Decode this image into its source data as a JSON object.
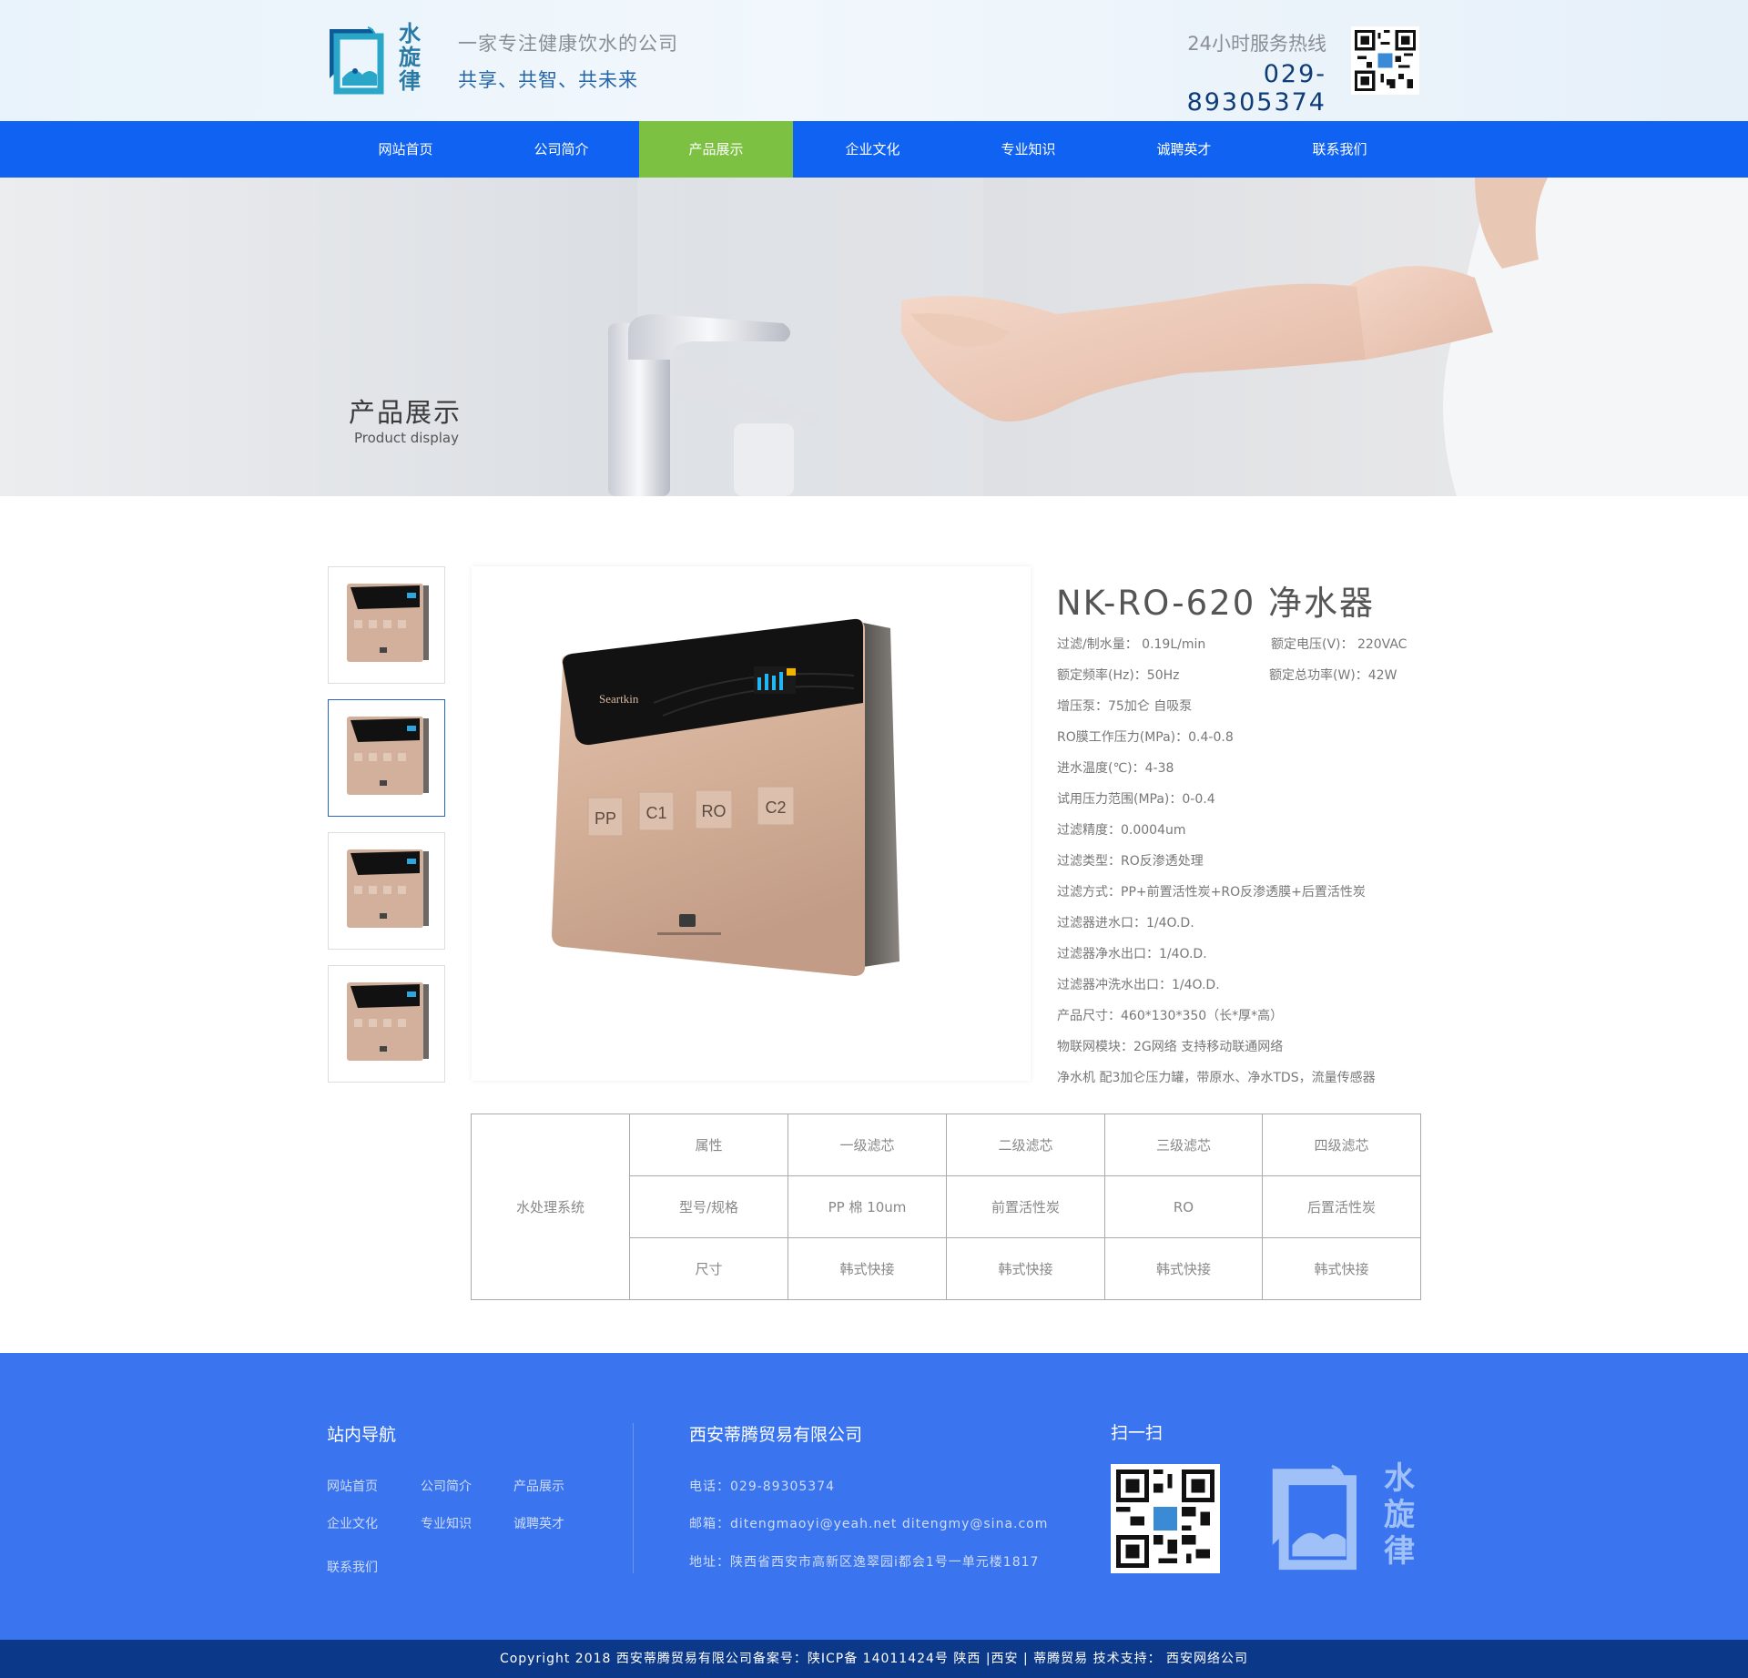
{
  "header": {
    "logo_text": "水旋律",
    "slogan_line1": "一家专注健康饮水的公司",
    "slogan_line2": "共享、共智、共未来",
    "hotline_label": "24小时服务热线",
    "hotline_number": "029-89305374"
  },
  "nav": {
    "items": [
      {
        "label": "网站首页"
      },
      {
        "label": "公司简介"
      },
      {
        "label": "产品展示"
      },
      {
        "label": "企业文化"
      },
      {
        "label": "专业知识"
      },
      {
        "label": "诚聘英才"
      },
      {
        "label": "联系我们"
      }
    ],
    "active_index": 2
  },
  "banner": {
    "title": "产品展示",
    "subtitle": "Product display"
  },
  "product": {
    "title": "NK-RO-620 净水器",
    "panel_labels": [
      "PP",
      "C1",
      "RO",
      "C2"
    ],
    "specs": [
      "过滤/制水量： 0.19L/min",
      "额定电压(V)： 220VAC",
      "额定频率(Hz)：50Hz",
      "额定总功率(W)：42W",
      "增压泵：75加仑 自吸泵",
      "RO膜工作压力(MPa)：0.4-0.8",
      "进水温度(℃)：4-38",
      "试用压力范围(MPa)：0-0.4",
      "过滤精度：0.0004um",
      "过滤类型：RO反渗透处理",
      "过滤方式：PP+前置活性炭+RO反渗透膜+后置活性炭",
      "过滤器进水口：1/4O.D.",
      "过滤器净水出口：1/4O.D.",
      "过滤器冲洗水出口：1/4O.D.",
      "产品尺寸：460*130*350（长*厚*高）",
      "物联网模块：2G网络 支持移动联通网络",
      "净水机 配3加仑压力罐，带原水、净水TDS，流量传感器"
    ]
  },
  "table": {
    "row_header": "水处理系统",
    "rows": [
      [
        "属性",
        "一级滤芯",
        "二级滤芯",
        "三级滤芯",
        "四级滤芯"
      ],
      [
        "型号/规格",
        "PP 棉 10um",
        "前置活性炭",
        "RO",
        "后置活性炭"
      ],
      [
        "尺寸",
        "韩式快接",
        "韩式快接",
        "韩式快接",
        "韩式快接"
      ]
    ]
  },
  "footer": {
    "nav_title": "站内导航",
    "nav_links": [
      "网站首页",
      "公司简介",
      "产品展示",
      "企业文化",
      "专业知识",
      "诚聘英才",
      "联系我们"
    ],
    "company_name": "西安蒂腾贸易有限公司",
    "phone": "电话：029-89305374",
    "email": "邮箱：ditengmaoyi@yeah.net  ditengmy@sina.com",
    "address": "地址：陕西省西安市高新区逸翠园i都会1号一单元楼1817",
    "scan_title": "扫一扫",
    "logo_text": "水旋律",
    "copyright": "Copyright  2018 西安蒂腾贸易有限公司备案号：陕ICP备 14011424号     陕西 |西安 |   蒂腾贸易     技术支持：  西安网络公司"
  },
  "colors": {
    "nav_bg": "#0f62f2",
    "nav_active": "#7cc142",
    "footer_bg": "#3a74ee",
    "copyright_bg": "#0b3888"
  }
}
